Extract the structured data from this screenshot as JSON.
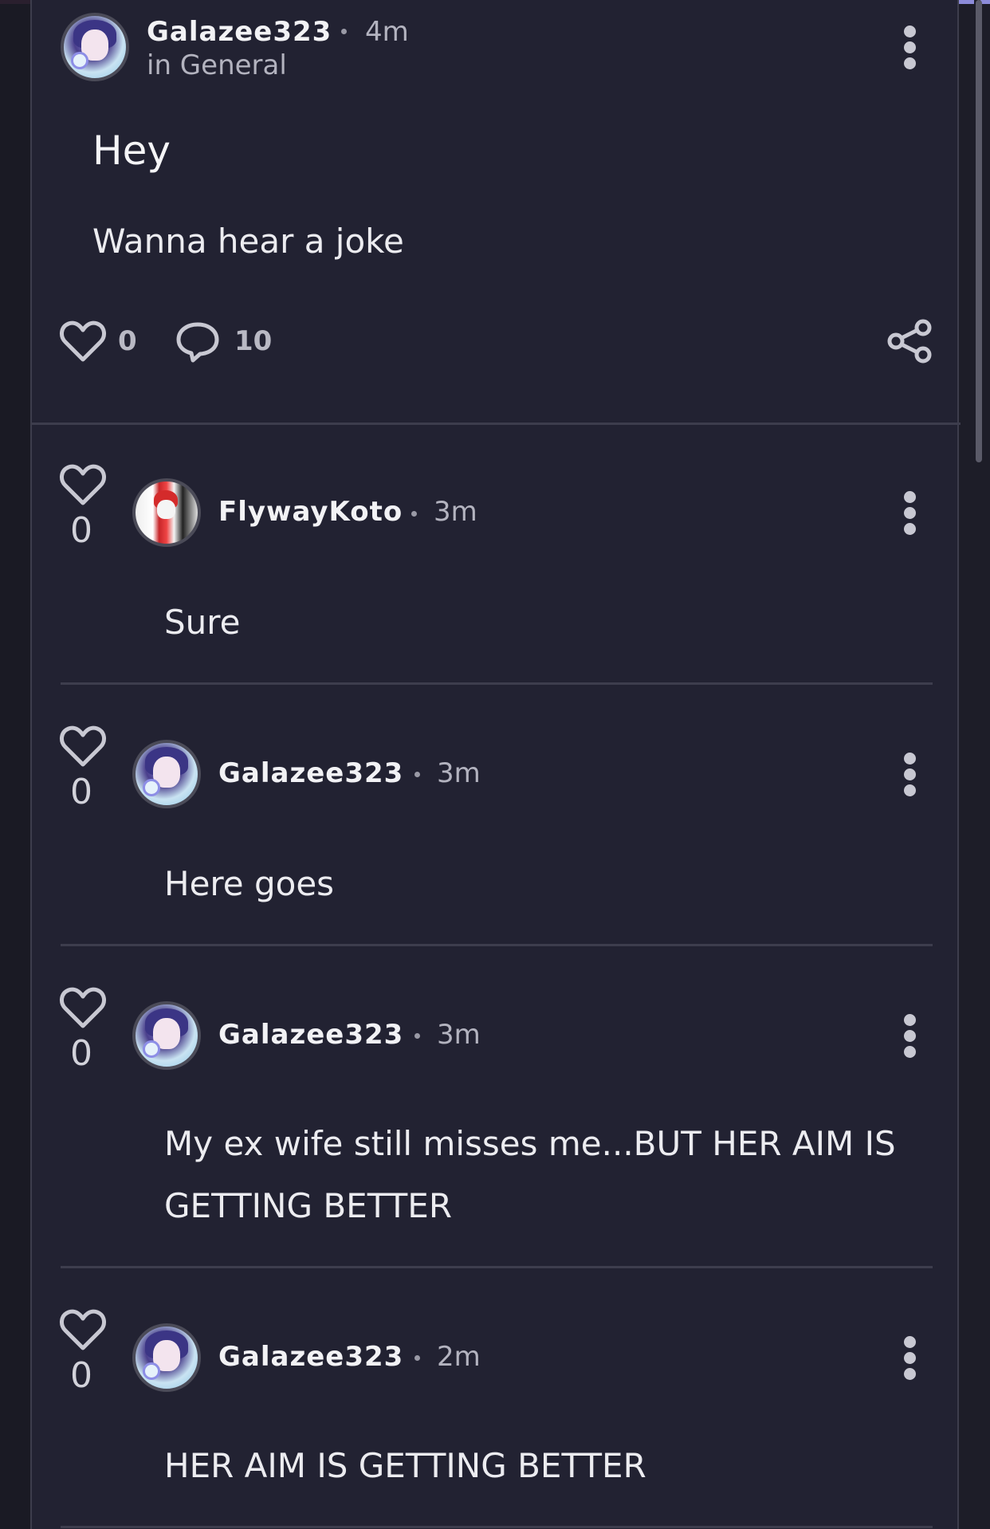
{
  "post": {
    "author": "Galazee323",
    "time": "4m",
    "community": "in General",
    "title": "Hey",
    "body": "Wanna hear a joke",
    "likes": "0",
    "comments": "10"
  },
  "comments": [
    {
      "author": "FlywayKoto",
      "time": "3m",
      "text": "Sure",
      "likes": "0"
    },
    {
      "author": "Galazee323",
      "time": "3m",
      "text": "Here goes",
      "likes": "0"
    },
    {
      "author": "Galazee323",
      "time": "3m",
      "text": "My ex wife still misses me...BUT HER AIM IS GETTING BETTER",
      "likes": "0"
    },
    {
      "author": "Galazee323",
      "time": "2m",
      "text": "HER AIM IS GETTING BETTER",
      "likes": "0"
    }
  ],
  "icons": {
    "like": "heart-outline-icon",
    "comment": "speech-bubble-icon",
    "share": "share-icon",
    "more": "vertical-dots-icon"
  },
  "colors": {
    "background": "#1d1d28",
    "panel": "#222232",
    "accent_bar": "#8c8bd9"
  }
}
